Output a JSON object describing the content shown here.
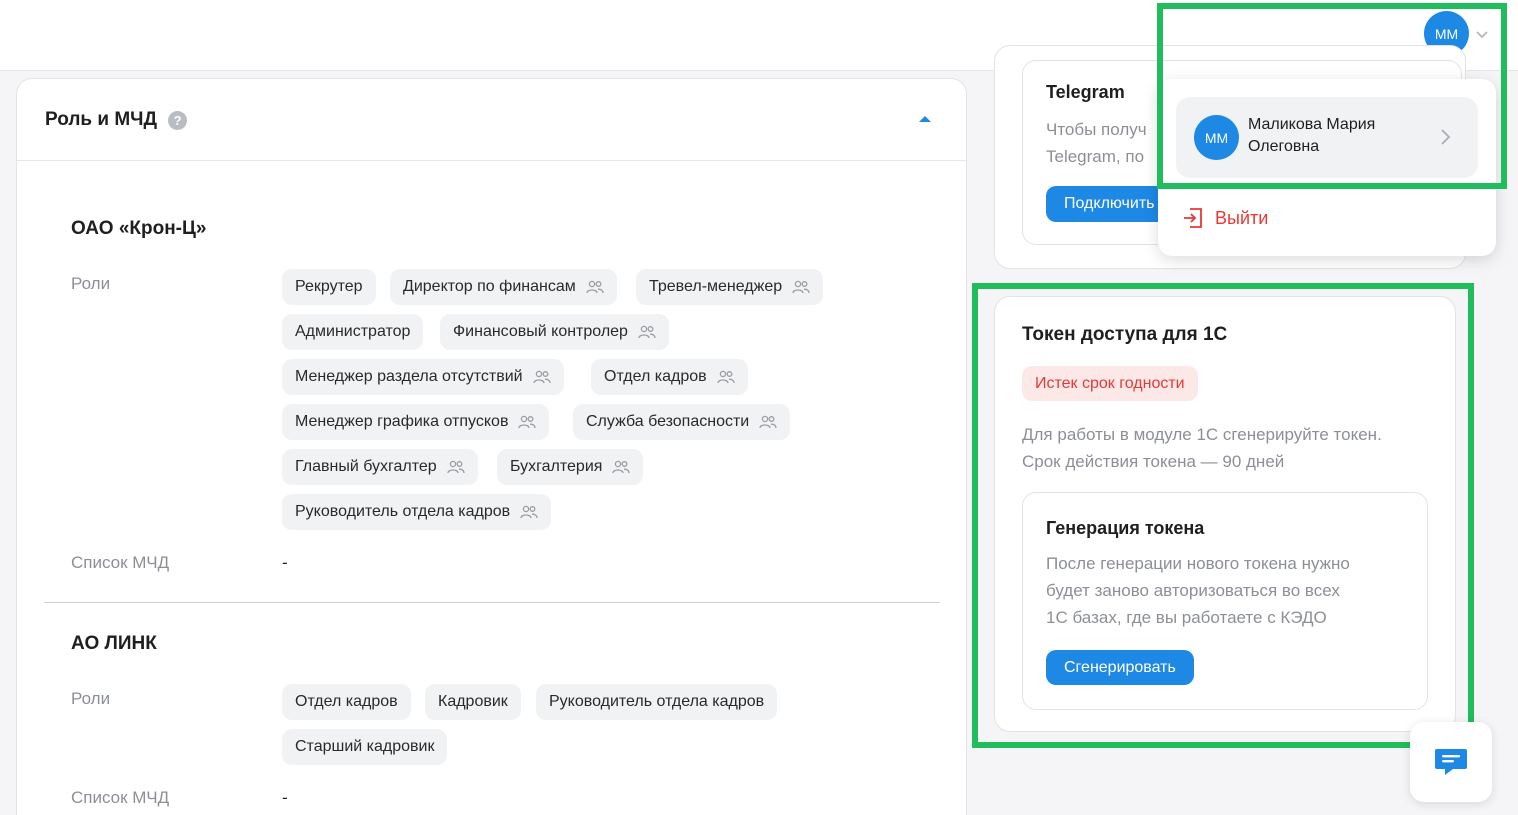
{
  "header": {
    "avatar_initials": "ММ"
  },
  "role_section": {
    "title": "Роль и МЧД",
    "help": "?",
    "orgs": [
      {
        "name": "ОАО «Крон-Ц»",
        "roles_label": "Роли",
        "roles": [
          "Рекрутер",
          "Директор по финансам",
          "Тревел-менеджер",
          "Администратор",
          "Финансовый контролер",
          "Менеджер раздела отсутствий",
          "Отдел кадров",
          "Менеджер графика отпусков",
          "Служба безопасности",
          "Главный бухгалтер",
          "Бухгалтерия",
          "Руководитель отдела кадров"
        ],
        "mchd_label": "Список МЧД",
        "mchd_value": "-"
      },
      {
        "name": "АО  ЛИНК",
        "roles_label": "Роли",
        "roles": [
          "Отдел кадров",
          "Кадровик",
          "Руководитель отдела кадров",
          "Старший кадровик"
        ],
        "mchd_label": "Список МЧД",
        "mchd_value": "-"
      }
    ]
  },
  "telegram": {
    "title": "Telegram",
    "text_line1": "Чтобы получ",
    "text_line2": "Telegram, по",
    "button": "Подключить"
  },
  "token": {
    "title": "Токен доступа для 1С",
    "status": "Истек срок годности",
    "description_line1": "Для работы в модуле 1С сгенерируйте токен.",
    "description_line2": "Срок действия токена — 90 дней",
    "generation": {
      "title": "Генерация токена",
      "text_line1": "После генерации нового токена нужно",
      "text_line2": "будет заново авторизоваться во всех",
      "text_line3": "1С базах, где вы работаете с КЭДО",
      "button": "Сгенерировать"
    }
  },
  "user_menu": {
    "initials": "ММ",
    "name_line1": "Маликова Мария",
    "name_line2": "Олеговна",
    "logout": "Выйти"
  },
  "colors": {
    "accent": "#1e88e5",
    "danger": "#e53935",
    "highlight": "#1fbd5c"
  }
}
